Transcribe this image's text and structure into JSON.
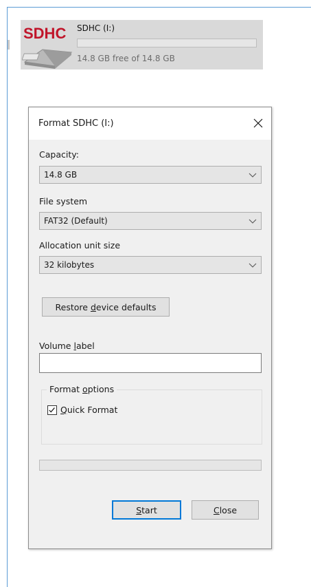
{
  "drive": {
    "logo_text": "SDHC",
    "name": "SDHC (I:)",
    "free_text": "14.8 GB free of 14.8 GB",
    "usage_fraction": 0
  },
  "dialog": {
    "title": "Format SDHC (I:)",
    "capacity": {
      "label": "Capacity:",
      "access_key": "p",
      "value": "14.8 GB"
    },
    "file_system": {
      "label": "File system",
      "access_key": "F",
      "value": "FAT32 (Default)"
    },
    "allocation": {
      "label": "Allocation unit size",
      "access_key": "A",
      "value": "32 kilobytes"
    },
    "restore_button": {
      "before": "Restore ",
      "key": "d",
      "after": "evice defaults"
    },
    "volume_label": {
      "label_before": "Volume ",
      "key": "l",
      "label_after": "abel",
      "value": ""
    },
    "format_options": {
      "legend_before": "Format ",
      "legend_key": "o",
      "legend_after": "ptions",
      "quick_format": {
        "key": "Q",
        "label_rest": "uick Format",
        "checked": true
      }
    },
    "progress_fraction": 0,
    "start_button": {
      "key": "S",
      "rest": "tart"
    },
    "close_button": {
      "key": "C",
      "rest": "lose"
    }
  },
  "colors": {
    "accent": "#0078d7",
    "window_edge": "#5b9bd5",
    "drive_tile": "#d9d9d9",
    "dialog_bg": "#f0f0f0"
  }
}
